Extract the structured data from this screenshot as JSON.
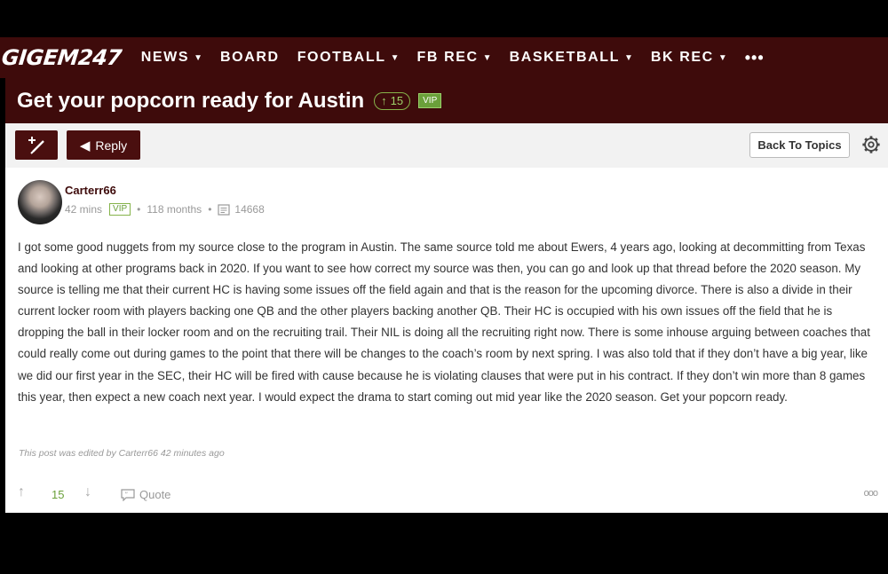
{
  "site": {
    "logo": "GIGEM247"
  },
  "nav": {
    "items": [
      {
        "label": "NEWS",
        "dropdown": true
      },
      {
        "label": "BOARD",
        "dropdown": false
      },
      {
        "label": "FOOTBALL",
        "dropdown": true
      },
      {
        "label": "FB REC",
        "dropdown": true
      },
      {
        "label": "BASKETBALL",
        "dropdown": true
      },
      {
        "label": "BK REC",
        "dropdown": true
      }
    ],
    "more": "•••"
  },
  "thread": {
    "title": "Get your popcorn ready for Austin",
    "upvotes": "15",
    "badge": "VIP"
  },
  "toolbar": {
    "compose_icon": "pencil-plus-icon",
    "reply_label": "Reply",
    "back_label": "Back To Topics",
    "settings_icon": "gear-icon"
  },
  "post": {
    "username": "Carterr66",
    "time": "42 mins",
    "badge": "VIP",
    "tenure": "118 months",
    "post_count": "14668",
    "body": "I got some good nuggets from my source close to the program in Austin. The same source told me about Ewers, 4 years ago, looking at decommitting from Texas and looking at other programs back in 2020. If you want to see how correct my source was then, you can go and look up that thread before the 2020 season. My source is telling me that their current HC is having some issues off the field again and that is the reason for the upcoming divorce. There is also a divide in their current locker room with players backing one QB and the other players backing another QB. Their HC is occupied with his own issues off the field that he is dropping the ball in their locker room and on the recruiting trail. Their NIL is doing all the recruiting right now. There is some inhouse arguing between coaches that could really come out during games to the point that there will be changes to the coach’s room by next spring. I was also told that if they don’t have a big year, like we did our first year in the SEC, their HC will be fired with cause because he is violating clauses that were put in his contract. If they don’t win more than 8 games this year, then expect a new coach next year. I would expect the drama to start coming out mid year like the 2020 season. Get your popcorn ready.",
    "edited_note": "This post was edited by Carterr66 42 minutes ago",
    "votes": "15",
    "quote_label": "Quote",
    "more": "ooo"
  },
  "colors": {
    "brand": "#3e0b0b",
    "accent_green": "#6aa03a"
  }
}
